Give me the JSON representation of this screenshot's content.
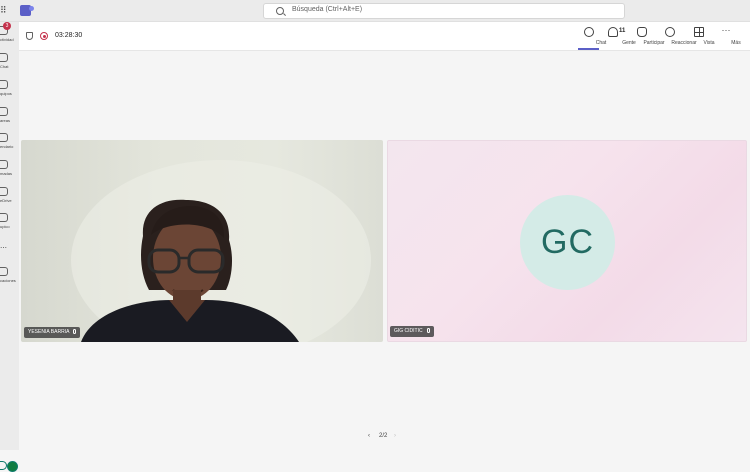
{
  "app": {
    "name": "Microsoft Teams"
  },
  "search": {
    "placeholder": "Búsqueda (Ctrl+Alt+E)"
  },
  "rail": {
    "items": [
      {
        "label": "ctividad",
        "badge": "3",
        "icon": "bell-icon"
      },
      {
        "label": "Chat",
        "icon": "chat-icon"
      },
      {
        "label": "quipos",
        "icon": "teams-icon"
      },
      {
        "label": "areas",
        "icon": "tasks-icon"
      },
      {
        "label": "endario",
        "icon": "calendar-icon"
      },
      {
        "label": "madas",
        "icon": "phone-icon"
      },
      {
        "label": "eDrive",
        "icon": "cloud-icon"
      },
      {
        "label": "upico",
        "icon": "apps-icon"
      },
      {
        "label": "caciones",
        "icon": "add-apps-icon"
      }
    ],
    "more": "⋯"
  },
  "call": {
    "timer": "03:28:30",
    "controls": [
      {
        "id": "chat",
        "label": "Chat",
        "icon": "chat-icon",
        "active": true
      },
      {
        "id": "people",
        "label": "Gente",
        "icon": "people-icon",
        "count": "11"
      },
      {
        "id": "raise",
        "label": "Participar",
        "icon": "hand-icon"
      },
      {
        "id": "react",
        "label": "Reaccionar",
        "icon": "smile-icon"
      },
      {
        "id": "view",
        "label": "Vista",
        "icon": "grid-view-icon"
      },
      {
        "id": "more",
        "label": "Más",
        "icon": "more-icon"
      }
    ]
  },
  "participants": [
    {
      "name": "YESENIA BARRIA",
      "type": "video",
      "muted": true
    },
    {
      "name": "GIG CIDITIC",
      "type": "avatar",
      "initials": "GC",
      "avatar_color": "#d4ebe7",
      "initials_color": "#226a62",
      "muted": true
    }
  ],
  "pager": {
    "prev": "‹",
    "label": "2/2",
    "next": "›"
  },
  "colors": {
    "accent": "#5b5fc7",
    "recording": "#c4314b"
  }
}
